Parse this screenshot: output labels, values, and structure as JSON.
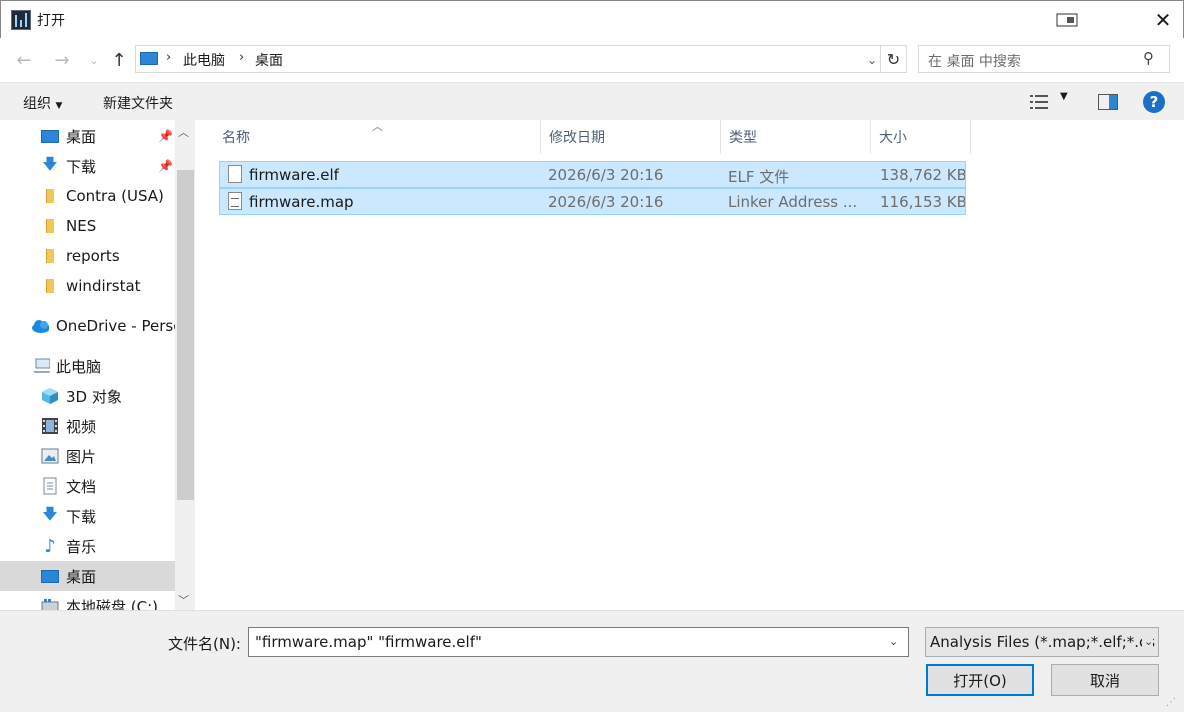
{
  "window": {
    "title": "打开"
  },
  "nav": {
    "breadcrumb": [
      "此电脑",
      "桌面"
    ],
    "search_placeholder": "在 桌面 中搜索"
  },
  "toolbar": {
    "organize_label": "组织",
    "new_folder_label": "新建文件夹"
  },
  "sidebar": {
    "items": [
      {
        "label": "桌面",
        "icon": "desktop-icon",
        "pinned": true
      },
      {
        "label": "下载",
        "icon": "download-arrow-icon",
        "pinned": true
      },
      {
        "label": "Contra (USA)",
        "icon": "folder-icon"
      },
      {
        "label": "NES",
        "icon": "folder-icon"
      },
      {
        "label": "reports",
        "icon": "folder-icon"
      },
      {
        "label": "windirstat",
        "icon": "folder-icon"
      },
      {
        "label": "OneDrive - Persc",
        "icon": "cloud-icon"
      },
      {
        "label": "此电脑",
        "icon": "computer-icon"
      },
      {
        "label": "3D 对象",
        "icon": "cube-icon"
      },
      {
        "label": "视频",
        "icon": "film-icon"
      },
      {
        "label": "图片",
        "icon": "picture-icon"
      },
      {
        "label": "文档",
        "icon": "document-icon"
      },
      {
        "label": "下载",
        "icon": "download-arrow-icon"
      },
      {
        "label": "音乐",
        "icon": "music-note-icon"
      },
      {
        "label": "桌面",
        "icon": "desktop-icon",
        "selected": true
      },
      {
        "label": "本地磁盘 (C:)",
        "icon": "drive-icon"
      }
    ]
  },
  "filelist": {
    "columns": [
      "名称",
      "修改日期",
      "类型",
      "大小"
    ],
    "rows": [
      {
        "name": "firmware.elf",
        "date": "2026/6/3 20:16",
        "type": "ELF 文件",
        "size": "138,762 KB"
      },
      {
        "name": "firmware.map",
        "date": "2026/6/3 20:16",
        "type": "Linker Address ...",
        "size": "116,153 KB"
      }
    ]
  },
  "bottom": {
    "filename_label": "文件名(N):",
    "filename_value": "\"firmware.map\" \"firmware.elf\"",
    "filter_value": "Analysis Files (*.map;*.elf;*.cs",
    "open_label": "打开(O)",
    "cancel_label": "取消"
  },
  "colors": {
    "selection_bg": "#cce8ff",
    "selection_border": "#99d1ff",
    "accent": "#0078d7",
    "folder": "#f4c65a"
  }
}
